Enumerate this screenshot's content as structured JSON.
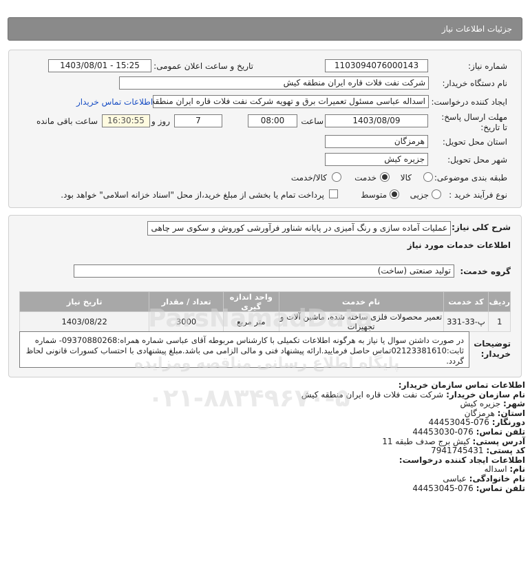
{
  "header": {
    "title": "جزئیات اطلاعات نیاز"
  },
  "labels": {
    "need_number": "شماره نیاز:",
    "announce_datetime": "تاریخ و ساعت اعلان عمومی:",
    "buyer_name": "نام دستگاه خریدار:",
    "creator": "ایجاد کننده درخواست:",
    "contact_link": "اطلاعات تماس خریدار",
    "deadline": "مهلت ارسال پاسخ: تا تاریخ:",
    "time_word": "ساعت",
    "day_word": "روز و",
    "remaining": "ساعت باقی مانده",
    "province": "استان محل تحویل:",
    "city": "شهر محل تحویل:",
    "category": "طبقه بندی موضوعی:",
    "process_type": "نوع فرآیند خرید :",
    "summary": "شرح کلی نیاز:",
    "services_info": "اطلاعات خدمات مورد نیاز",
    "service_group": "گروه خدمت:",
    "buyer_notes": "توضیحات خریدار:"
  },
  "fields": {
    "need_number": "1103094076000143",
    "announce_datetime": "1403/08/01 - 15:25",
    "buyer_name": "شرکت نفت فلات قاره ایران منطقه کیش",
    "creator": "اسداله  عباسی  مسئول تعمیرات برق و تهویه  شرکت نفت فلات قاره ایران منطقه کیش",
    "deadline_date": "1403/08/09",
    "deadline_time": "08:00",
    "days": "7",
    "remaining_time": "16:30:55",
    "province": "هرمزگان",
    "city": "جزیره کیش",
    "summary": "عملیات آماده سازی و رنگ آمیزی در پایانه شناور فرآورشی کوروش و سکوی سر چاهی",
    "service_group": "تولید صنعتی (ساخت)"
  },
  "category_options": [
    {
      "label": "کالا",
      "selected": false
    },
    {
      "label": "خدمت",
      "selected": true
    },
    {
      "label": "کالا/خدمت",
      "selected": false
    }
  ],
  "process_options": [
    {
      "label": "جزیی",
      "selected": false
    },
    {
      "label": "متوسط",
      "selected": true
    }
  ],
  "treasury_note": "پرداخت تمام یا بخشی از مبلغ خرید،از محل \"اسناد خزانه اسلامی\" خواهد بود.",
  "table": {
    "headers": [
      "ردیف",
      "کد خدمت",
      "نام خدمت",
      "واحد اندازه گیری",
      "تعداد / مقدار",
      "تاریخ نیاز"
    ],
    "rows": [
      [
        "1",
        "پ-33-331",
        "تعمیر محصولات فلزی ساخته شده، ماشین آلات و تجهیزات",
        "متر مربع",
        "3000",
        "1403/08/22"
      ]
    ]
  },
  "buyer_notes": "در صورت داشتن سوال یا نیاز به هرگونه اطلاعات تکمیلی با کارشناس مربوطه آقای عباسی شماره همراه:09370880268- شماره ثابت:02123381610تماس حاصل فرمایید.ارائه پیشنهاد فنی و مالی الزامی می باشد.مبلغ پیشنهادی با احتساب کسورات قانونی لحاظ گردد.",
  "contact": {
    "buyer_heading": "اطلاعات تماس سازمان خریدار:",
    "org_label": "نام سازمان خریدار:",
    "org_value": "شرکت نفت فلات قاره ایران منطقه کیش",
    "city_label": "شهر:",
    "city_value": "جزیره کیش",
    "province_label": "استان:",
    "province_value": "هرمزگان",
    "fax_label": "دورنگار:",
    "fax_value": "076-44453045",
    "phone_label": "تلفن تماس:",
    "phone_value": "076-44453030",
    "address_label": "آدرس پستی:",
    "address_value": "کیش برج صدف طبقه 11",
    "postal_label": "کد پستی:",
    "postal_value": "7941745431",
    "creator_heading": "اطلاعات ایجاد کننده درخواست:",
    "name_label": "نام:",
    "name_value": "اسداله",
    "family_label": "نام خانوادگی:",
    "family_value": "عباسی",
    "creator_phone_label": "تلفن تماس:",
    "creator_phone_value": "076-44453045"
  },
  "watermark": {
    "brand": "ParsNamadData",
    "tagline": "پایگاه اطلاع رسانی مناقصه ومزایده",
    "phone": "۰۲۱-۸۸۳۴۹۶۷۰-۵"
  }
}
